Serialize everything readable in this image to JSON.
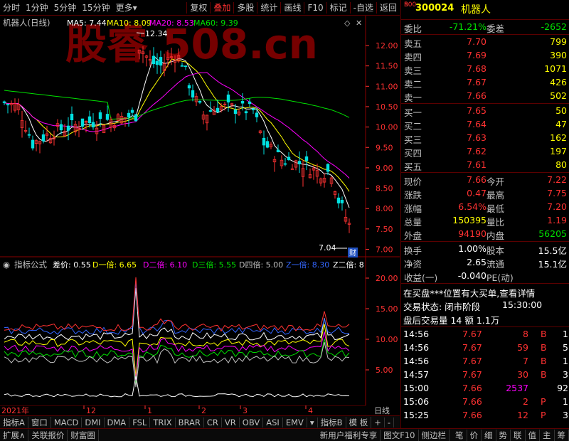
{
  "toolbar": {
    "items": [
      "分时",
      "1分钟",
      "5分钟",
      "15分钟",
      "更多"
    ],
    "more_arrow": "▾",
    "actions": [
      "复权",
      "叠加",
      "多股",
      "统计",
      "画线",
      "F10",
      "标记",
      "-自选",
      "返回"
    ]
  },
  "main": {
    "title": "机器人(日线)",
    "ma": [
      {
        "label": "MA5: 7.44",
        "color": "#ffffff"
      },
      {
        "label": "MA10: 8.09",
        "color": "#ffff00"
      },
      {
        "label": "MA20: 8.53",
        "color": "#ff00ff"
      },
      {
        "label": "MA60: 9.39",
        "color": "#00e000"
      }
    ],
    "high_mark": "12.34",
    "low_mark": "7.04",
    "cai_label": "财",
    "axis_ticks": [
      "12.00",
      "11.50",
      "11.00",
      "10.50",
      "10.00",
      "9.50",
      "9.00",
      "8.50",
      "8.00",
      "7.50",
      "7.00"
    ]
  },
  "indicator": {
    "title": "指标公式",
    "items": [
      {
        "label": "差价: 0.55",
        "color": "#ffffff"
      },
      {
        "label": "D一倍: 6.65",
        "color": "#ffff00"
      },
      {
        "label": "D二倍: 6.10",
        "color": "#ff00ff"
      },
      {
        "label": "D三倍: 5.55",
        "color": "#00e000"
      },
      {
        "label": "D四倍: 5.00",
        "color": "#c0c0c0"
      },
      {
        "label": "Z一倍: 8.30",
        "color": "#3366ff"
      },
      {
        "label": "Z二倍: 8",
        "color": "#ffffff"
      }
    ],
    "axis_ticks": [
      "20.00",
      "15.00",
      "10.00",
      "5.00"
    ]
  },
  "dates": {
    "labels": [
      "2021年",
      "12",
      "1",
      "2",
      "3",
      "4"
    ],
    "period": "日线"
  },
  "tabs_bottom1": [
    "指标A",
    "窗口",
    "MACD",
    "DMI",
    "DMA",
    "FSL",
    "TRIX",
    "BRAR",
    "CR",
    "VR",
    "OBV",
    "ASI",
    "EMV",
    "▾",
    "指标B",
    "模 板",
    "+",
    "-"
  ],
  "tabs_bottom2": {
    "left": [
      "扩展∧",
      "关联报价",
      "财富圈"
    ],
    "right": [
      "新用户福利专享",
      "图文F10",
      "侧边栏"
    ],
    "icons": [
      "笔",
      "价",
      "细",
      "势",
      "联",
      "值",
      "主",
      "筹"
    ]
  },
  "watermark": "股睿 508.cn",
  "quote": {
    "badge_r": "R",
    "badge_num": "500",
    "code": "300024",
    "name": "机器人",
    "weibi_label": "委比",
    "weibi": "-71.21%",
    "weicha_label": "委差",
    "weicha": "-2652",
    "asks": [
      {
        "label": "卖五",
        "price": "7.70",
        "vol": "799"
      },
      {
        "label": "卖四",
        "price": "7.69",
        "vol": "390"
      },
      {
        "label": "卖三",
        "price": "7.68",
        "vol": "1071"
      },
      {
        "label": "卖二",
        "price": "7.67",
        "vol": "426"
      },
      {
        "label": "卖一",
        "price": "7.66",
        "vol": "502"
      }
    ],
    "bids": [
      {
        "label": "买一",
        "price": "7.65",
        "vol": "50"
      },
      {
        "label": "买二",
        "price": "7.64",
        "vol": "47"
      },
      {
        "label": "买三",
        "price": "7.63",
        "vol": "162"
      },
      {
        "label": "买四",
        "price": "7.62",
        "vol": "197"
      },
      {
        "label": "买五",
        "price": "7.61",
        "vol": "80"
      }
    ],
    "stats": [
      {
        "l1": "现价",
        "v1": "7.66",
        "c1": "red",
        "l2": "今开",
        "v2": "7.22",
        "c2": "red"
      },
      {
        "l1": "涨跌",
        "v1": "0.47",
        "c1": "red",
        "l2": "最高",
        "v2": "7.75",
        "c2": "red"
      },
      {
        "l1": "涨幅",
        "v1": "6.54%",
        "c1": "red",
        "l2": "最低",
        "v2": "7.20",
        "c2": "red"
      },
      {
        "l1": "总量",
        "v1": "150395",
        "c1": "yellow",
        "l2": "量比",
        "v2": "1.19",
        "c2": "red"
      },
      {
        "l1": "外盘",
        "v1": "94190",
        "c1": "red",
        "l2": "内盘",
        "v2": "56205",
        "c2": "green"
      }
    ],
    "stats2": [
      {
        "l1": "换手",
        "v1": "1.00%",
        "l2": "股本",
        "v2": "15.5亿"
      },
      {
        "l1": "净资",
        "v1": "2.65",
        "l2": "流通",
        "v2": "15.1亿"
      },
      {
        "l1": "收益(一)",
        "v1": "-0.040",
        "l2": "PE(动)",
        "v2": ""
      }
    ],
    "notice": "在买盘***位置有大买单,查看详情",
    "status_label": "交易状态: 闭市阶段",
    "status_time": "15:30:00",
    "after_hours": "盘后交易量 14 额 1.1万",
    "ticks": [
      {
        "t": "14:56",
        "p": "7.67",
        "v": "8",
        "s": "B",
        "n": "1",
        "vc": "red"
      },
      {
        "t": "14:56",
        "p": "7.67",
        "v": "59",
        "s": "B",
        "n": "5",
        "vc": "red"
      },
      {
        "t": "14:56",
        "p": "7.67",
        "v": "7",
        "s": "B",
        "n": "1",
        "vc": "red"
      },
      {
        "t": "14:57",
        "p": "7.67",
        "v": "30",
        "s": "B",
        "n": "3",
        "vc": "red"
      },
      {
        "t": "15:00",
        "p": "7.66",
        "v": "2537",
        "s": "",
        "n": "92",
        "vc": "mag"
      },
      {
        "t": "15:06",
        "p": "7.66",
        "v": "2",
        "s": "P",
        "n": "1",
        "vc": "red"
      },
      {
        "t": "15:25",
        "p": "7.66",
        "v": "12",
        "s": "P",
        "n": "3",
        "vc": "red"
      }
    ]
  }
}
